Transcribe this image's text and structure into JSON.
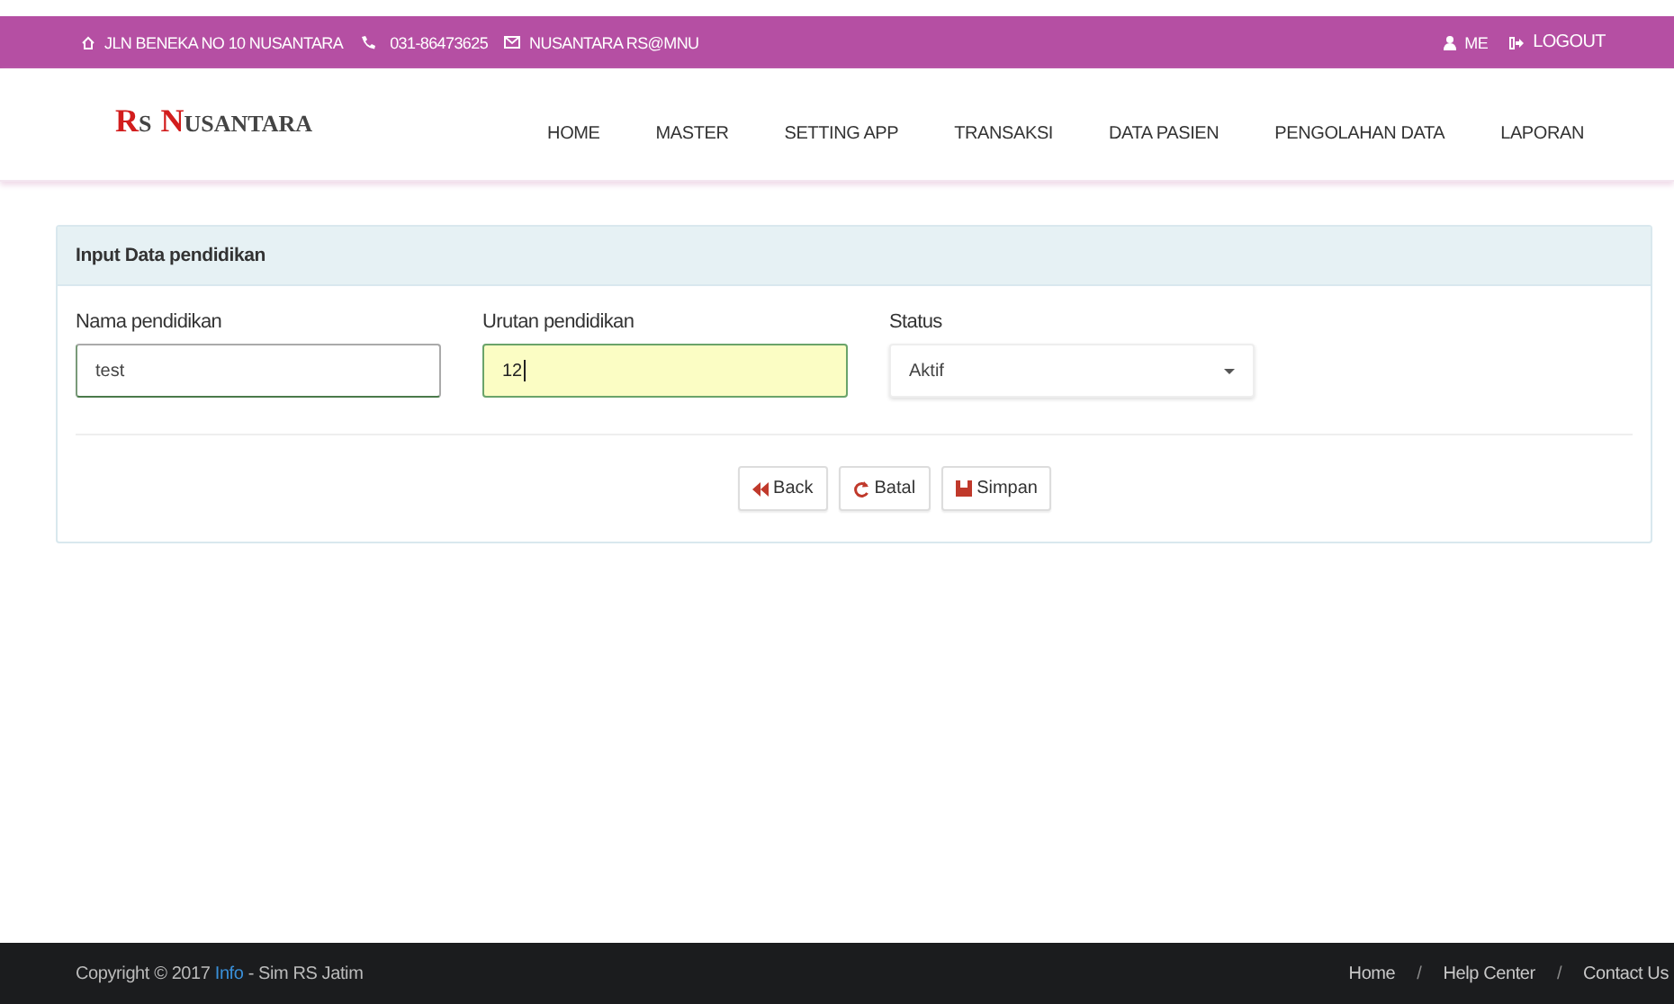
{
  "top_bar": {
    "address": "JLN BENEKA NO 10 NUSANTARA",
    "phone": "031-86473625",
    "email": "NUSANTARA RS@MNU",
    "user": "ME",
    "logout": "LOGOUT"
  },
  "header": {
    "logo": [
      "RS",
      "NUSANTARA"
    ],
    "nav": [
      {
        "label": "HOME"
      },
      {
        "label": "MASTER"
      },
      {
        "label": "SETTING APP"
      },
      {
        "label": "TRANSAKSI"
      },
      {
        "label": "DATA PASIEN"
      },
      {
        "label": "PENGOLAHAN DATA"
      },
      {
        "label": "LAPORAN"
      }
    ]
  },
  "panel": {
    "title": "Input Data pendidikan",
    "fields": [
      {
        "kind": "text",
        "label": "Nama pendidikan",
        "value": "test",
        "focused": false
      },
      {
        "kind": "text",
        "label": "Urutan pendidikan",
        "value": "12",
        "focused": true
      },
      {
        "kind": "select",
        "label": "Status",
        "value": "Aktif",
        "focused": false
      }
    ],
    "buttons": [
      {
        "kind": "back",
        "label": "Back"
      },
      {
        "kind": "reset",
        "label": "Batal"
      },
      {
        "kind": "save",
        "label": "Simpan"
      }
    ]
  },
  "footer": {
    "prefix": "Copyright © 2017",
    "link": "Info",
    "suffix": "- Sim RS Jatim",
    "links": [
      {
        "kind": "link",
        "text": "Home"
      },
      {
        "kind": "separator",
        "text": "/"
      },
      {
        "kind": "link",
        "text": "Help Center"
      },
      {
        "kind": "separator",
        "text": "/"
      },
      {
        "kind": "link",
        "text": "Contact Us"
      }
    ]
  }
}
